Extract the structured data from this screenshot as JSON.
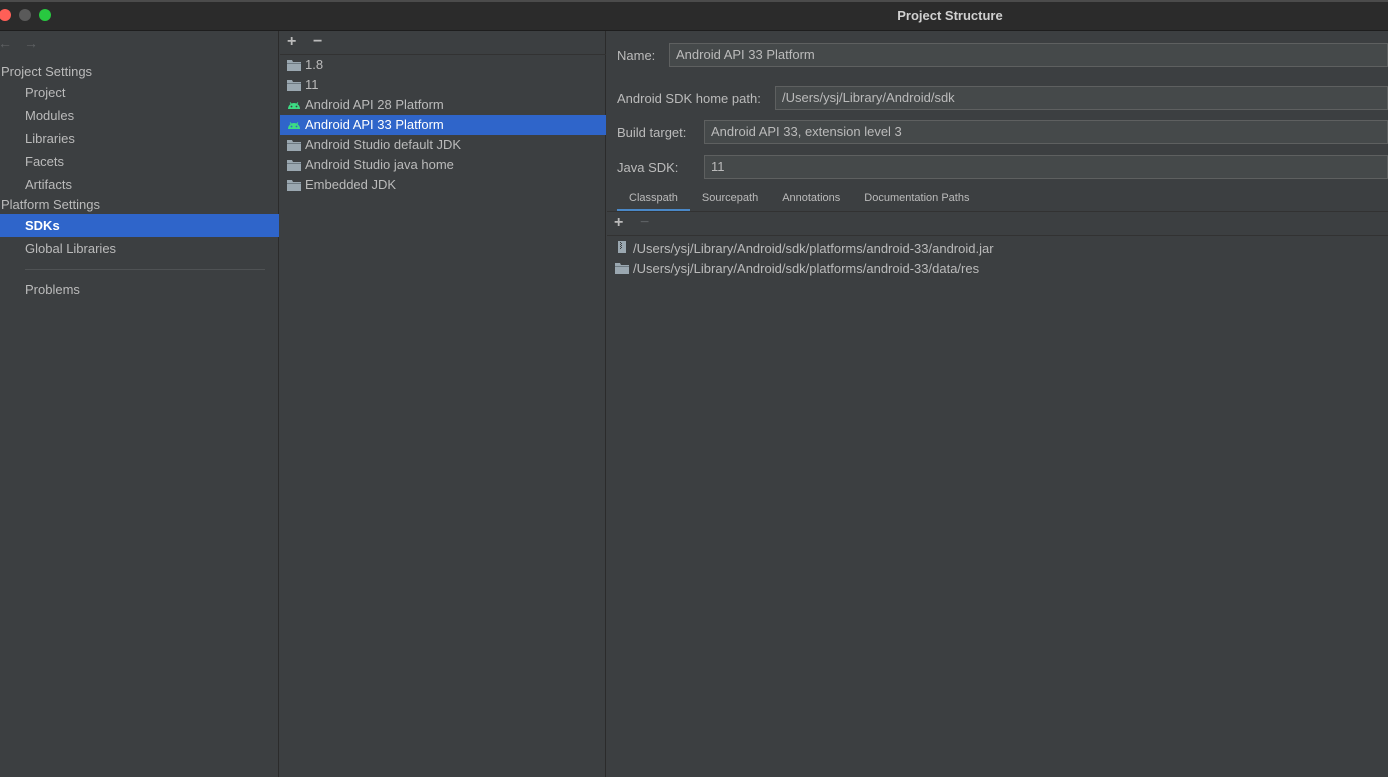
{
  "window": {
    "title": "Project Structure"
  },
  "nav": {
    "back_icon": "arrow-left-icon",
    "forward_icon": "arrow-right-icon",
    "project_settings_label": "Project Settings",
    "project_settings_items": [
      "Project",
      "Modules",
      "Libraries",
      "Facets",
      "Artifacts"
    ],
    "platform_settings_label": "Platform Settings",
    "platform_settings_items": [
      "SDKs",
      "Global Libraries"
    ],
    "problems_label": "Problems",
    "selected": "SDKs"
  },
  "sdk_list": {
    "add_label": "+",
    "remove_label": "−",
    "items": [
      {
        "label": "1.8",
        "icon": "folder-icon"
      },
      {
        "label": "11",
        "icon": "folder-icon"
      },
      {
        "label": "Android API 28 Platform",
        "icon": "android-icon"
      },
      {
        "label": "Android API 33 Platform",
        "icon": "android-icon"
      },
      {
        "label": "Android Studio default JDK",
        "icon": "folder-icon"
      },
      {
        "label": "Android Studio java home",
        "icon": "folder-icon"
      },
      {
        "label": "Embedded JDK",
        "icon": "folder-icon"
      }
    ],
    "selected": "Android API 33 Platform"
  },
  "detail": {
    "name_label": "Name:",
    "name_value": "Android API 33 Platform",
    "sdk_home_label": "Android SDK home path:",
    "sdk_home_value": "/Users/ysj/Library/Android/sdk",
    "build_target_label": "Build target:",
    "build_target_value": "Android API 33, extension level 3",
    "java_sdk_label": "Java SDK:",
    "java_sdk_value": "11",
    "tabs": [
      "Classpath",
      "Sourcepath",
      "Annotations",
      "Documentation Paths"
    ],
    "active_tab": "Classpath",
    "classpath_add": "+",
    "classpath_remove": "−",
    "classpath": [
      {
        "path": "/Users/ysj/Library/Android/sdk/platforms/android-33/android.jar",
        "icon": "jar-icon"
      },
      {
        "path": "/Users/ysj/Library/Android/sdk/platforms/android-33/data/res",
        "icon": "folder-icon"
      }
    ]
  },
  "colors": {
    "background": "#3c3f41",
    "selection": "#2f65ca",
    "android_green": "#3ddc84",
    "folder": "#9aa7b0"
  }
}
